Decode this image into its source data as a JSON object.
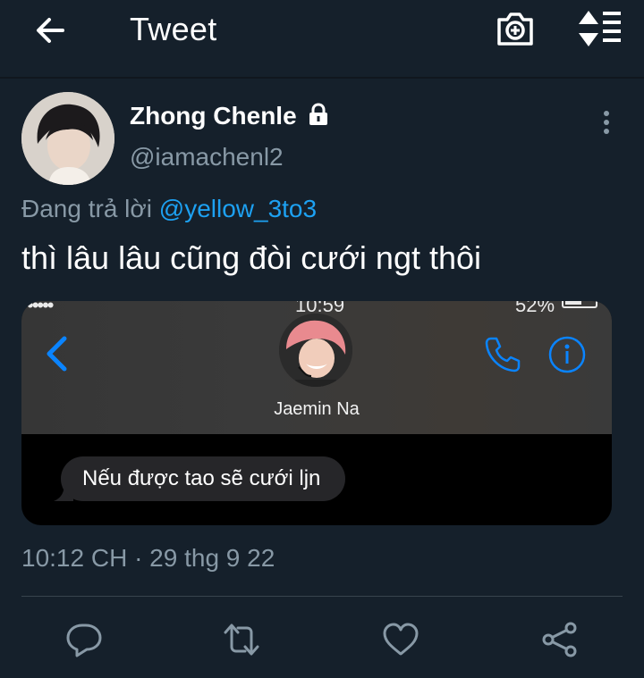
{
  "header": {
    "title": "Tweet",
    "icons": [
      "back-arrow-icon",
      "camera-add-icon",
      "sort-icon"
    ]
  },
  "tweet": {
    "author": {
      "name": "Zhong Chenle",
      "handle": "@iamachenl2",
      "protected_icon": "lock-icon"
    },
    "reply_prefix": "Đang trả lời",
    "reply_to": "@yellow_3to3",
    "text": "thì lâu lâu cũng đòi cưới ngt thôi",
    "timestamp": "10:12 CH · 29 thg 9 22"
  },
  "media": {
    "status_bar": {
      "signal": "•••••",
      "time": "10:59",
      "battery": "52%"
    },
    "contact_name": "Jaemin Na",
    "message": "Nếu được tao sẽ cưới ljn",
    "icons": [
      "chevron-left-icon",
      "phone-icon",
      "info-icon"
    ]
  },
  "actions": [
    "reply-icon",
    "retweet-icon",
    "like-icon",
    "share-icon"
  ],
  "colors": {
    "background": "#15202b",
    "secondary_text": "#8899a6",
    "link": "#1da1f2",
    "ios_blue": "#0a84ff",
    "divider": "#38444d"
  }
}
